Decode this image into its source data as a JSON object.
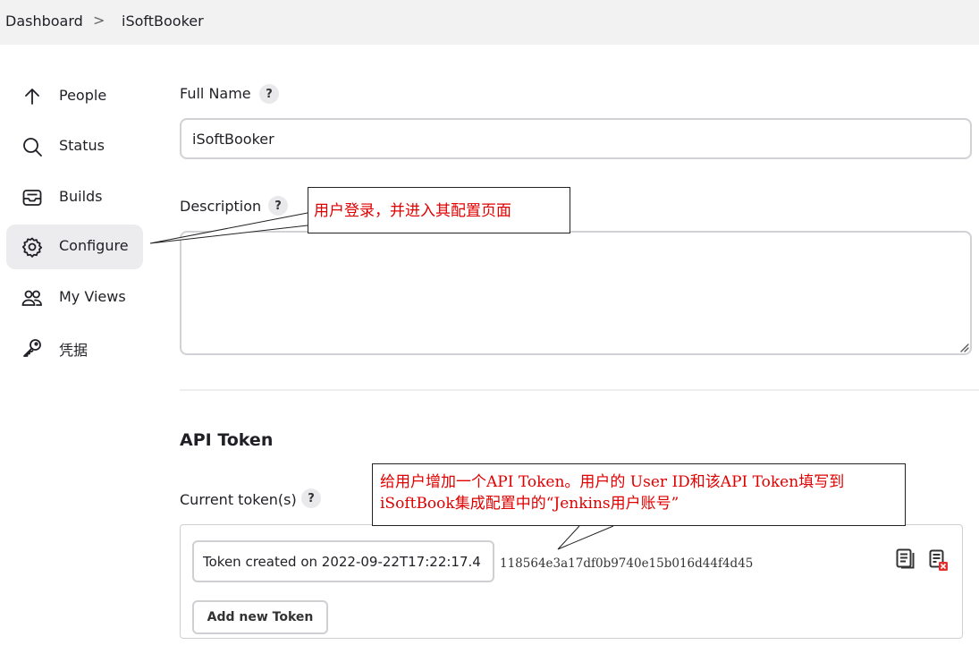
{
  "breadcrumb": {
    "root": "Dashboard",
    "separator": ">",
    "current": "iSoftBooker"
  },
  "sidebar": {
    "items": [
      {
        "label": "People",
        "icon": "arrow-up-icon"
      },
      {
        "label": "Status",
        "icon": "search-icon"
      },
      {
        "label": "Builds",
        "icon": "inbox-icon"
      },
      {
        "label": "Configure",
        "icon": "gear-icon",
        "active": true
      },
      {
        "label": "My Views",
        "icon": "users-icon"
      },
      {
        "label": "凭据",
        "icon": "key-icon"
      }
    ]
  },
  "form": {
    "full_name_label": "Full Name",
    "full_name_value": "iSoftBooker",
    "description_label": "Description",
    "description_value": "",
    "help_glyph": "?"
  },
  "api_token": {
    "section_title": "API Token",
    "current_tokens_label": "Current token(s)",
    "token_name": "Token created on 2022-09-22T17:22:17.4",
    "token_value": "118564e3a17df0b9740e15b016d44f4d45",
    "add_button_label": "Add new Token"
  },
  "annotations": {
    "configure_note": "用户登录，并进入其配置页面",
    "token_note_line1": "给用户增加一个API Token。用户的 User ID和该API Token填写到",
    "token_note_line2": "iSoftBook集成配置中的“Jenkins用户账号”",
    "text_color": "#e00000"
  }
}
